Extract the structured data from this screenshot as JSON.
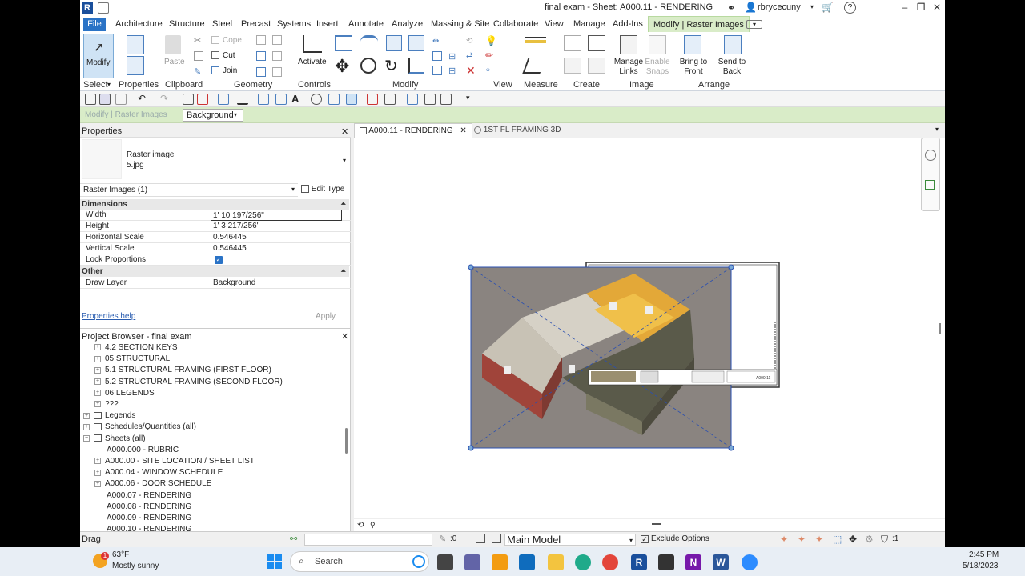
{
  "title_bar": {
    "title": "final exam - Sheet: A000.11 - RENDERING",
    "user": "rbrycecuny",
    "help_icon": "question-icon"
  },
  "menu_tabs": [
    "File",
    "Architecture",
    "Structure",
    "Steel",
    "Precast",
    "Systems",
    "Insert",
    "Annotate",
    "Analyze",
    "Massing & Site",
    "Collaborate",
    "View",
    "Manage",
    "Add-Ins",
    "Modify | Raster Images"
  ],
  "ribbon": {
    "select": {
      "button": "Modify",
      "label": "Select"
    },
    "properties": {
      "label": "Properties"
    },
    "clipboard": {
      "paste": "Paste",
      "cope": "Cope",
      "cut": "Cut",
      "join": "Join",
      "label": "Clipboard"
    },
    "geometry": {
      "label": "Geometry"
    },
    "controls": {
      "activate": "Activate",
      "label": "Controls"
    },
    "modify": {
      "label": "Modify"
    },
    "view": {
      "label": "View"
    },
    "measure": {
      "label": "Measure"
    },
    "create": {
      "label": "Create"
    },
    "image": {
      "manage_links": [
        "Manage",
        "Links"
      ],
      "enable_snaps": [
        "Enable",
        "Snaps"
      ],
      "label": "Image"
    },
    "arrange": {
      "bring_to_front": [
        "Bring to",
        "Front"
      ],
      "send_to_back": [
        "Send to",
        "Back"
      ],
      "label": "Arrange"
    }
  },
  "options_bar": {
    "context": "Modify | Raster Images",
    "draw_layer": "Background"
  },
  "properties_panel": {
    "title": "Properties",
    "type_name": "Raster image",
    "type_file": "5.jpg",
    "selector": "Raster Images (1)",
    "edit_type": "Edit Type",
    "groups": [
      {
        "name": "Dimensions",
        "rows": [
          {
            "key": "Width",
            "value": "1'  10 197/256\""
          },
          {
            "key": "Height",
            "value": "1'  3 217/256\""
          },
          {
            "key": "Horizontal Scale",
            "value": "0.546445"
          },
          {
            "key": "Vertical Scale",
            "value": "0.546445"
          },
          {
            "key": "Lock Proportions",
            "value": ""
          }
        ]
      },
      {
        "name": "Other",
        "rows": [
          {
            "key": "Draw Layer",
            "value": "Background"
          }
        ]
      }
    ],
    "help": "Properties help",
    "apply": "Apply"
  },
  "project_browser": {
    "title": "Project Browser - final exam",
    "items": [
      {
        "label": "4.2 SECTION KEYS",
        "indent": 2,
        "expand": true
      },
      {
        "label": "05 STRUCTURAL",
        "indent": 2,
        "expand": true
      },
      {
        "label": "5.1 STRUCTURAL FRAMING (FIRST FLOOR)",
        "indent": 2,
        "expand": true
      },
      {
        "label": "5.2 STRUCTURAL FRAMING (SECOND FLOOR)",
        "indent": 2,
        "expand": true
      },
      {
        "label": "06 LEGENDS",
        "indent": 2,
        "expand": true
      },
      {
        "label": "???",
        "indent": 2,
        "expand": true
      },
      {
        "label": "Legends",
        "indent": 0,
        "expand": true
      },
      {
        "label": "Schedules/Quantities (all)",
        "indent": 0,
        "expand": true
      },
      {
        "label": "Sheets (all)",
        "indent": 0,
        "expand": false
      },
      {
        "label": "A000.000 - RUBRIC",
        "indent": 2,
        "expand": null
      },
      {
        "label": "A000.00 - SITE LOCATION / SHEET LIST",
        "indent": 2,
        "expand": true
      },
      {
        "label": "A000.04 - WINDOW SCHEDULE",
        "indent": 2,
        "expand": true
      },
      {
        "label": "A000.06 - DOOR SCHEDULE",
        "indent": 2,
        "expand": true
      },
      {
        "label": "A000.07 - RENDERING",
        "indent": 2,
        "expand": null
      },
      {
        "label": "A000.08 - RENDERING",
        "indent": 2,
        "expand": null
      },
      {
        "label": "A000.09 - RENDERING",
        "indent": 2,
        "expand": null
      },
      {
        "label": "A000.10 - RENDERING",
        "indent": 2,
        "expand": null
      }
    ]
  },
  "view_tabs": [
    {
      "label": "A000.11 - RENDERING",
      "active": true
    },
    {
      "label": "1ST FL FRAMING 3D",
      "active": false
    }
  ],
  "sheet_stamp": "A000.11",
  "status_bar": {
    "hint": "Drag",
    "selection_count": ":0",
    "model": "Main Model",
    "exclude_options": "Exclude Options",
    "filter_count": ":1"
  },
  "taskbar": {
    "weather_temp": "63°F",
    "weather_desc": "Mostly sunny",
    "search": "Search",
    "time": "2:45 PM",
    "date": "5/18/2023",
    "badge": "1"
  }
}
